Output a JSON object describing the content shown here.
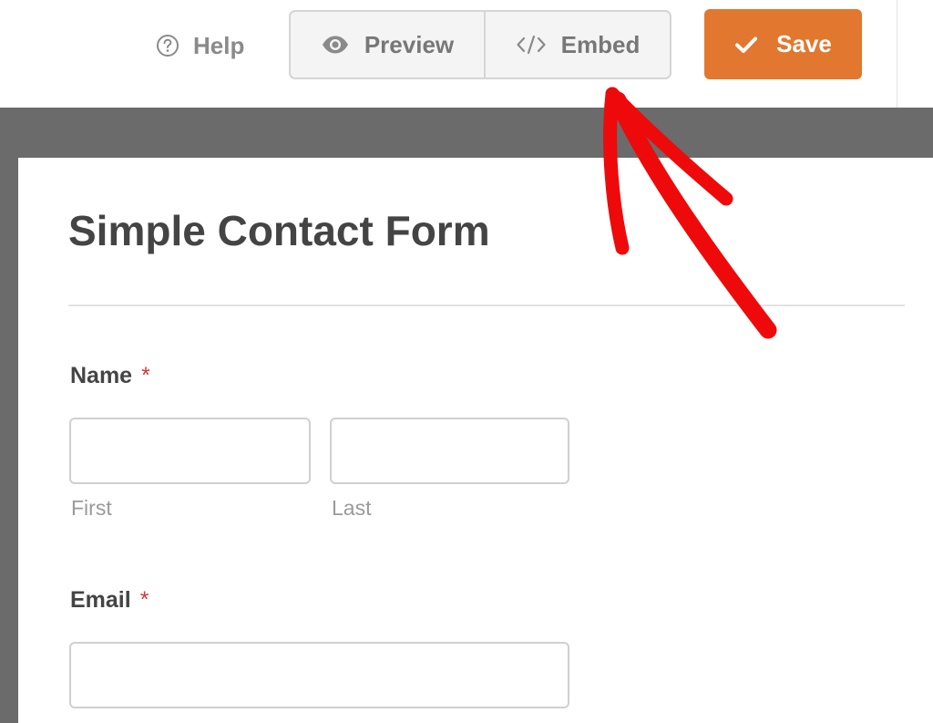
{
  "toolbar": {
    "help_label": "Help",
    "help_icon": "question-circle-icon",
    "preview_label": "Preview",
    "preview_icon": "eye-icon",
    "embed_label": "Embed",
    "embed_icon": "code-brackets-icon",
    "save_label": "Save",
    "save_icon": "checkmark-icon"
  },
  "form": {
    "title": "Simple Contact Form",
    "required_marker": "*",
    "fields": {
      "name": {
        "label": "Name",
        "first_sublabel": "First",
        "last_sublabel": "Last",
        "first_value": "",
        "last_value": ""
      },
      "email": {
        "label": "Email",
        "value": ""
      }
    }
  },
  "annotation": {
    "arrow_icon": "red-arrow-annotation",
    "color": "#ee0a0a"
  },
  "colors": {
    "accent": "#e27730",
    "required": "#d63638",
    "preview_background": "#6b6b6b"
  }
}
